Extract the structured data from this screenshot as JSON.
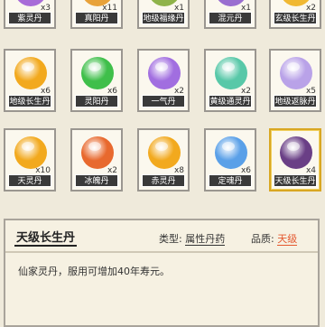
{
  "inventory": {
    "rows": [
      [
        {
          "name": "紫灵丹",
          "count": "x3",
          "color": "#a86cd8"
        },
        {
          "name": "真阳丹",
          "count": "x11",
          "color": "#e8a23a"
        },
        {
          "name": "地级福缘丹",
          "count": "x1",
          "color": "#8fb34a"
        },
        {
          "name": "混元丹",
          "count": "x1",
          "color": "#9a6fd0"
        },
        {
          "name": "玄级长生丹",
          "count": "x2",
          "color": "#f0b832"
        }
      ],
      [
        {
          "name": "地级长生丹",
          "count": "x6",
          "color": "#f2a91e"
        },
        {
          "name": "灵阳丹",
          "count": "x6",
          "color": "#3fbf4a"
        },
        {
          "name": "一气丹",
          "count": "x2",
          "color": "#a16ee0"
        },
        {
          "name": "黄级通灵丹",
          "count": "x2",
          "color": "#58c8a8"
        },
        {
          "name": "地级返脉丹",
          "count": "x5",
          "color": "#b9a2e8"
        }
      ],
      [
        {
          "name": "天灵丹",
          "count": "x10",
          "color": "#f2a91e"
        },
        {
          "name": "冰魄丹",
          "count": "x2",
          "color": "#e8692e"
        },
        {
          "name": "赤灵丹",
          "count": "x8",
          "color": "#f2a91e"
        },
        {
          "name": "定魂丹",
          "count": "x6",
          "color": "#5aa0e8"
        },
        {
          "name": "天级长生丹",
          "count": "x4",
          "color": "#6a3f86"
        }
      ]
    ],
    "selected_index": 14
  },
  "detail": {
    "title": "天级长生丹",
    "type_label": "类型:",
    "type_value": "属性丹药",
    "grade_label": "品质:",
    "grade_value": "天级",
    "description": "仙家灵丹，服用可增加40年寿元。"
  },
  "colors": {
    "selected_border": "#d9a722",
    "grade": "#e4572e",
    "name_bar": "#3a3a3a"
  }
}
